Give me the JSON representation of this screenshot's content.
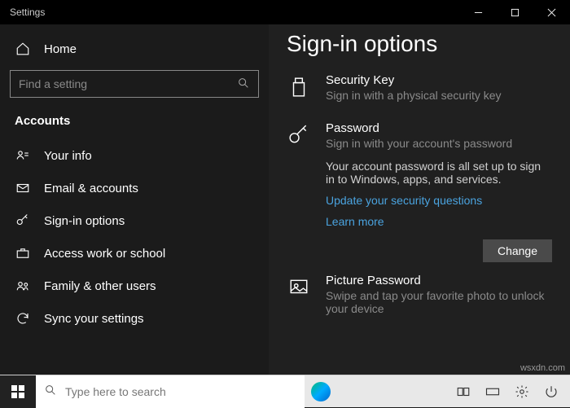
{
  "titlebar": {
    "title": "Settings"
  },
  "sidebar": {
    "home": "Home",
    "search_placeholder": "Find a setting",
    "section": "Accounts",
    "items": [
      {
        "label": "Your info"
      },
      {
        "label": "Email & accounts"
      },
      {
        "label": "Sign-in options"
      },
      {
        "label": "Access work or school"
      },
      {
        "label": "Family & other users"
      },
      {
        "label": "Sync your settings"
      }
    ]
  },
  "main": {
    "heading": "Sign-in options",
    "security_key": {
      "title": "Security Key",
      "sub": "Sign in with a physical security key"
    },
    "password": {
      "title": "Password",
      "sub": "Sign in with your account's password",
      "desc": "Your account password is all set up to sign in to Windows, apps, and services.",
      "link1": "Update your security questions",
      "link2": "Learn more",
      "change": "Change"
    },
    "picture": {
      "title": "Picture Password",
      "sub": "Swipe and tap your favorite photo to unlock your device"
    }
  },
  "taskbar": {
    "search_placeholder": "Type here to search"
  },
  "watermark": "wsxdn.com"
}
